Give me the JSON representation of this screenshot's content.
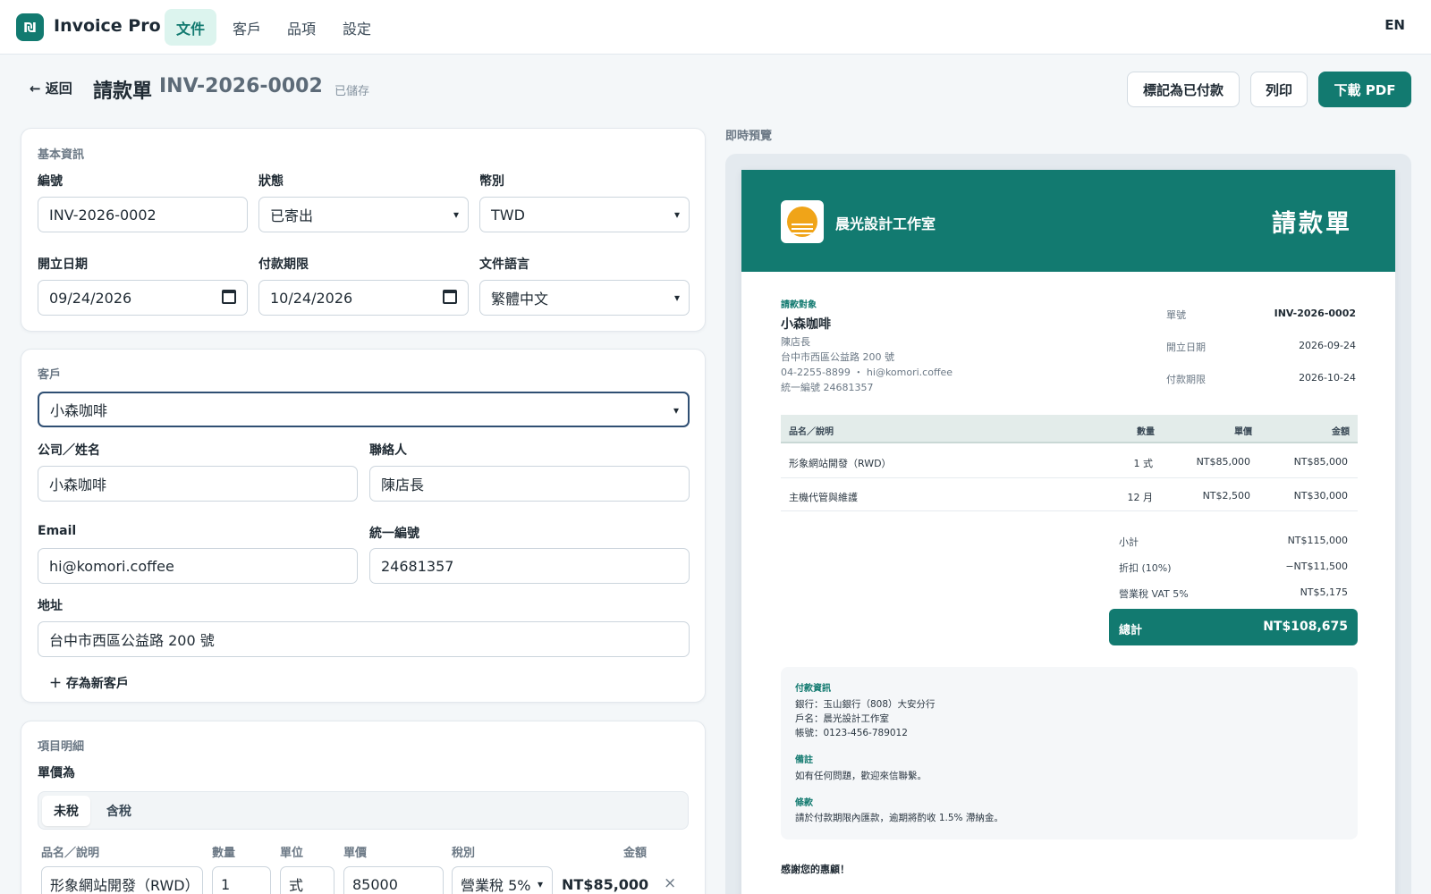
{
  "brand": {
    "logo": "₪",
    "name": "Invoice Pro"
  },
  "nav": {
    "tabs": [
      "文件",
      "客戶",
      "品項",
      "設定"
    ],
    "lang": "EN"
  },
  "header": {
    "back": "← 返回",
    "title": "請款單",
    "number": "INV-2026-0002",
    "saved": "已儲存",
    "mark_paid": "標記為已付款",
    "print": "列印",
    "download": "下載 PDF"
  },
  "basic": {
    "title": "基本資訊",
    "number_label": "編號",
    "number_value": "INV-2026-0002",
    "status_label": "狀態",
    "status_value": "已寄出",
    "currency_label": "幣別",
    "currency_value": "TWD",
    "issue_label": "開立日期",
    "issue_value": "09/24/2026",
    "due_label": "付款期限",
    "due_value": "10/24/2026",
    "lang_label": "文件語言",
    "lang_value": "繁體中文"
  },
  "client": {
    "title": "客戶",
    "select_value": "小森咖啡",
    "company_label": "公司／姓名",
    "company_value": "小森咖啡",
    "contact_label": "聯絡人",
    "contact_value": "陳店長",
    "email_label": "Email",
    "email_value": "hi@komori.coffee",
    "taxid_label": "統一編號",
    "taxid_value": "24681357",
    "address_label": "地址",
    "address_value": "台中市西區公益路 200 號",
    "save_new": "＋ 存為新客戶"
  },
  "items": {
    "title": "項目明細",
    "price_mode_label": "單價為",
    "mode_excl": "未稅",
    "mode_incl": "含稅",
    "headers": [
      "品名／說明",
      "數量",
      "單位",
      "單價",
      "稅別",
      "金額"
    ],
    "row": {
      "name": "形象網站開發（RWD）",
      "qty": "1",
      "unit": "式",
      "price": "85000",
      "tax": "營業稅 5%",
      "amount": "NT$85,000",
      "remove": "×"
    }
  },
  "preview": {
    "label": "即時預覽",
    "company": "晨光設計工作室",
    "doc_kind": "請款單",
    "bill_to_tag": "請款對象",
    "client_name": "小森咖啡",
    "client_contact": "陳店長",
    "client_address": "台中市西區公益路 200 號",
    "client_phone_email": "04-2255-8899 ・ hi@komori.coffee",
    "client_taxid": "統一編號 24681357",
    "meta": [
      {
        "label": "單號",
        "value": "INV-2026-0002"
      },
      {
        "label": "開立日期",
        "value": "2026-09-24"
      },
      {
        "label": "付款期限",
        "value": "2026-10-24"
      }
    ],
    "table_headers": [
      "品名／說明",
      "數量",
      "單價",
      "金額"
    ],
    "lines": [
      {
        "name": "形象網站開發（RWD）",
        "qty": "1 式",
        "price": "NT$85,000",
        "amount": "NT$85,000"
      },
      {
        "name": "主機代管與維護",
        "qty": "12 月",
        "price": "NT$2,500",
        "amount": "NT$30,000"
      }
    ],
    "subtotal_label": "小計",
    "subtotal": "NT$115,000",
    "discount_label": "折扣 (10%)",
    "discount": "−NT$11,500",
    "tax_label": "營業稅 VAT 5%",
    "tax": "NT$5,175",
    "total_label": "總計",
    "total": "NT$108,675",
    "pay_tag": "付款資訊",
    "bank": "銀行：玉山銀行（808）大安分行",
    "account_name": "戶名：晨光設計工作室",
    "account_no": "帳號：0123-456-789012",
    "note_tag": "備註",
    "note": "如有任何問題，歡迎來信聯繫。",
    "terms_tag": "條款",
    "terms": "請於付款期限內匯款，逾期將酌收 1.5% 滯納金。",
    "thanks": "感謝您的惠顧！"
  },
  "colors": {
    "accent": "#127a70",
    "logo_sun": "#f0a418"
  }
}
